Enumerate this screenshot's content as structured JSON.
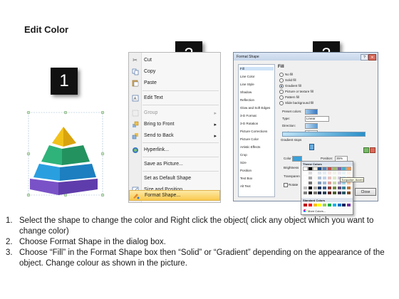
{
  "title": "Edit Color",
  "step_badges": [
    "1",
    "2",
    "3"
  ],
  "context_menu": {
    "items": [
      {
        "label": "Cut",
        "icon": "scissors-icon",
        "enabled": true
      },
      {
        "label": "Copy",
        "icon": "copy-icon",
        "enabled": true
      },
      {
        "label": "Paste",
        "icon": "paste-icon",
        "enabled": true
      },
      {
        "label": "Edit Text",
        "icon": "edit-text-icon",
        "enabled": true
      },
      {
        "label": "Group",
        "icon": "group-icon",
        "enabled": false
      },
      {
        "label": "Bring to Front",
        "icon": "bring-front-icon",
        "enabled": true
      },
      {
        "label": "Send to Back",
        "icon": "send-back-icon",
        "enabled": true
      },
      {
        "label": "Hyperlink...",
        "icon": "hyperlink-icon",
        "enabled": true
      },
      {
        "label": "Save as Picture...",
        "icon": "",
        "enabled": true
      },
      {
        "label": "Set as Default Shape",
        "icon": "",
        "enabled": true
      },
      {
        "label": "Size and Position...",
        "icon": "size-position-icon",
        "enabled": true
      },
      {
        "label": "Format Shape...",
        "icon": "format-shape-icon",
        "enabled": true,
        "highlighted": true
      }
    ]
  },
  "format_dialog": {
    "title": "Format Shape",
    "categories": [
      "Fill",
      "Line Color",
      "Line Style",
      "Shadow",
      "Reflection",
      "Glow and Soft Edges",
      "3-D Format",
      "3-D Rotation",
      "Picture Corrections",
      "Picture Color",
      "Artistic Effects",
      "Crop",
      "Size",
      "Position",
      "Text Box",
      "Alt Text"
    ],
    "selected_category": "Fill",
    "section_title": "Fill",
    "fill_options": [
      "No fill",
      "Solid fill",
      "Gradient fill",
      "Picture or texture fill",
      "Pattern fill",
      "Slide background fill"
    ],
    "selected_fill": "Gradient fill",
    "preset_colors_label": "Preset colors:",
    "type_label": "Type:",
    "type_value": "Linear",
    "direction_label": "Direction:",
    "angle_label": "Angle:",
    "angle_value": "0°",
    "gradient_stops_label": "Gradient stops",
    "color_label": "Color",
    "position_label": "Position:",
    "position_value": "35%",
    "brightness_label": "Brightness",
    "transparency_label": "Transparen",
    "rotate_label": "Rotate",
    "theme_colors_label": "Theme Colors",
    "standard_colors_label": "Standard Colors",
    "more_colors_label": "More Colors...",
    "tooltip": "Turquoise, Accent 3",
    "close_label": "Close"
  },
  "steps": [
    {
      "num": "1.",
      "text": "Select the shape to change the color and Right click the object( click any object which you want to change color)"
    },
    {
      "num": "2.",
      "text": "Choose Format Shape in the dialog box."
    },
    {
      "num": "3.",
      "text": "Choose “Fill” in the Format Shape box then “Solid” or “Gradient” depending on the appearance of the object. Change colour as shown in the picture."
    }
  ],
  "colors": {
    "pyramid_top": "#f2c21b",
    "pyramid_second": "#2fb37a",
    "pyramid_third": "#2a9fe0",
    "pyramid_base": "#7a52c7",
    "menu_highlight": "#f9c94e"
  }
}
